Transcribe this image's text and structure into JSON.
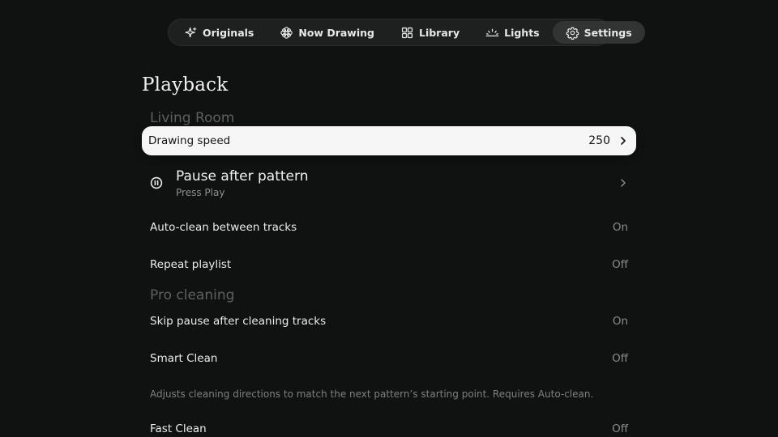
{
  "nav": {
    "items": [
      {
        "label": "Originals",
        "icon": "sparkle-icon"
      },
      {
        "label": "Now Drawing",
        "icon": "flower-icon"
      },
      {
        "label": "Library",
        "icon": "grid-icon"
      },
      {
        "label": "Lights",
        "icon": "sunrise-icon"
      },
      {
        "label": "Settings",
        "icon": "gear-icon",
        "active": true
      }
    ]
  },
  "page": {
    "title": "Playback"
  },
  "sections": {
    "living_room": "Living Room",
    "pro_cleaning": "Pro cleaning"
  },
  "rows": {
    "drawing_speed": {
      "label": "Drawing speed",
      "value": "250"
    },
    "pause_after_pattern": {
      "label": "Pause after pattern",
      "sub": "Press Play"
    },
    "auto_clean": {
      "label": "Auto-clean between tracks",
      "value": "On"
    },
    "repeat_playlist": {
      "label": "Repeat playlist",
      "value": "Off"
    },
    "skip_pause": {
      "label": "Skip pause after cleaning tracks",
      "value": "On"
    },
    "smart_clean": {
      "label": "Smart Clean",
      "value": "Off"
    },
    "fast_clean": {
      "label": "Fast Clean",
      "value": "Off"
    }
  },
  "smart_clean_description": "Adjusts cleaning directions to match the next pattern’s starting point. Requires Auto-clean.",
  "colors": {
    "background": "#101111",
    "nav_background": "#1e1f1f",
    "nav_active": "#323333",
    "focused_row": "#f6f6f6",
    "section_title": "#5e6060",
    "secondary_text": "#8a8c8c"
  }
}
